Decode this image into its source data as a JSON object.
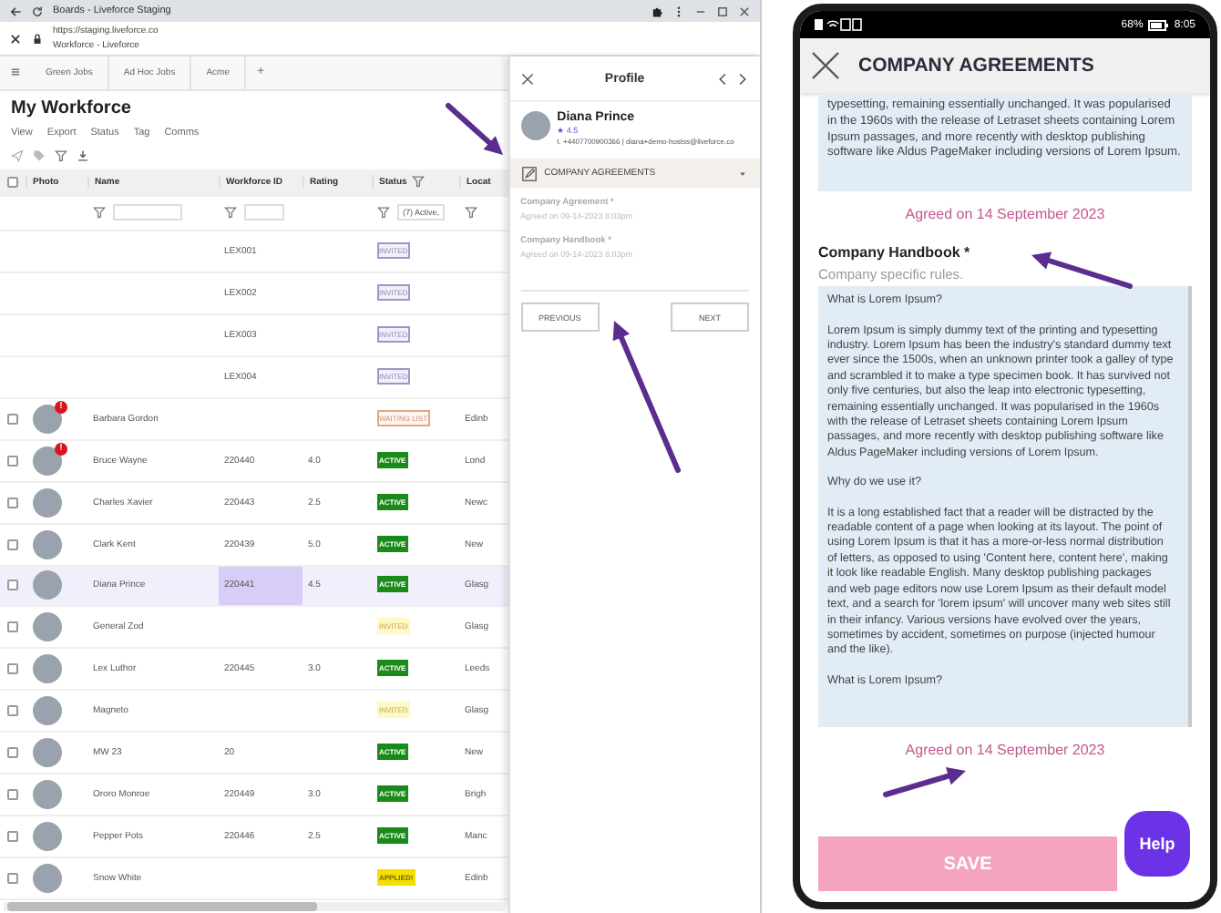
{
  "browser": {
    "tab_title": "Boards - Liveforce Staging",
    "url": "https://staging.liveforce.co",
    "site_title": "Workforce - Liveforce"
  },
  "tabs": [
    {
      "label": "Green Jobs",
      "selected": false
    },
    {
      "label": "Ad Hoc Jobs",
      "selected": false
    },
    {
      "label": "Acme",
      "selected": false
    }
  ],
  "add_tab": "+",
  "page": {
    "title": "My Workforce",
    "menu": [
      "View",
      "Export",
      "Status",
      "Tag",
      "Comms"
    ]
  },
  "table": {
    "select_all_checked": false,
    "columns": [
      {
        "label": "Photo",
        "filter": false,
        "header_filter": false
      },
      {
        "label": "Name",
        "filter": true,
        "header_filter": false
      },
      {
        "label": "Workforce ID",
        "filter": true,
        "header_filter": false
      },
      {
        "label": "Rating",
        "filter": false,
        "header_filter": false
      },
      {
        "label": "Status",
        "filter": true,
        "header_filter": true
      },
      {
        "label": "Locat",
        "filter": true,
        "header_filter": false
      }
    ],
    "status_filter": "(7) Active,",
    "rows": [
      {
        "kind": "invite",
        "workforce_id": "LEX001",
        "status": {
          "label": "INVITED",
          "kind": "invited"
        },
        "selected": false
      },
      {
        "kind": "invite",
        "workforce_id": "LEX002",
        "status": {
          "label": "INVITED",
          "kind": "invited"
        },
        "selected": false
      },
      {
        "kind": "invite",
        "workforce_id": "LEX003",
        "status": {
          "label": "INVITED",
          "kind": "invited"
        },
        "selected": false
      },
      {
        "kind": "invite",
        "workforce_id": "LEX004",
        "status": {
          "label": "INVITED",
          "kind": "invited"
        },
        "selected": false
      },
      {
        "kind": "person",
        "checked": false,
        "alert": "!",
        "name": "Barbara Gordon",
        "status": {
          "label": "WAITING LIST",
          "kind": "waiting"
        },
        "location": "Edinb",
        "selected": false
      },
      {
        "kind": "person",
        "checked": false,
        "alert": "!",
        "name": "Bruce Wayne",
        "workforce_id": "220440",
        "rating": "4.0",
        "status": {
          "label": "ACTIVE",
          "kind": "active"
        },
        "location": "Lond",
        "selected": false
      },
      {
        "kind": "person",
        "checked": false,
        "alert": false,
        "name": "Charles Xavier",
        "workforce_id": "220443",
        "rating": "2.5",
        "status": {
          "label": "ACTIVE",
          "kind": "active"
        },
        "location": "Newc",
        "selected": false
      },
      {
        "kind": "person",
        "checked": false,
        "alert": false,
        "name": "Clark Kent",
        "workforce_id": "220439",
        "rating": "5.0",
        "status": {
          "label": "ACTIVE",
          "kind": "active"
        },
        "location": "New",
        "selected": false
      },
      {
        "kind": "person",
        "checked": false,
        "alert": false,
        "name": "Diana Prince",
        "workforce_id": "220441",
        "rating": "4.5",
        "status": {
          "label": "ACTIVE",
          "kind": "active"
        },
        "location": "Glasg",
        "selected": true
      },
      {
        "kind": "person",
        "checked": false,
        "alert": false,
        "name": "General Zod",
        "status": {
          "label": "INVITED",
          "kind": "pending"
        },
        "location": "Glasg",
        "selected": false
      },
      {
        "kind": "person",
        "checked": false,
        "alert": false,
        "name": "Lex Luthor",
        "workforce_id": "220445",
        "rating": "3.0",
        "status": {
          "label": "ACTIVE",
          "kind": "active"
        },
        "location": "Leeds",
        "selected": false
      },
      {
        "kind": "person",
        "checked": false,
        "alert": false,
        "name": "Magneto",
        "status": {
          "label": "INVITED",
          "kind": "pending"
        },
        "location": "Glasg",
        "selected": false
      },
      {
        "kind": "person",
        "checked": false,
        "alert": false,
        "name": "MW 23",
        "workforce_id": "20",
        "status": {
          "label": "ACTIVE",
          "kind": "active"
        },
        "location": "New",
        "selected": false
      },
      {
        "kind": "person",
        "checked": false,
        "alert": false,
        "name": "Ororo Monroe",
        "workforce_id": "220449",
        "rating": "3.0",
        "status": {
          "label": "ACTIVE",
          "kind": "active"
        },
        "location": "Brigh",
        "selected": false
      },
      {
        "kind": "person",
        "checked": false,
        "alert": false,
        "name": "Pepper Pots",
        "workforce_id": "220446",
        "rating": "2.5",
        "status": {
          "label": "ACTIVE",
          "kind": "active"
        },
        "location": "Manc",
        "selected": false
      },
      {
        "kind": "person",
        "checked": false,
        "alert": false,
        "name": "Snow White",
        "status": {
          "label": "APPLIED!",
          "kind": "applied"
        },
        "location": "Edinb",
        "selected": false
      }
    ]
  },
  "profile": {
    "title": "Profile",
    "name": "Diana Prince",
    "star": "★",
    "rating": "4.5",
    "contact": "t. +4407700900366 | diana+demo-hostss@liveforce.co",
    "section": {
      "title": "COMPANY AGREEMENTS",
      "expanded": true
    },
    "items": [
      {
        "label": "Company Agreement *",
        "agreed": "Agreed on 09-14-2023 8:03pm"
      },
      {
        "label": "Company Handbook *",
        "agreed": "Agreed on 09-14-2023 8:03pm"
      }
    ],
    "buttons": [
      "PREVIOUS",
      "NEXT"
    ]
  },
  "phone": {
    "battery": "68%",
    "time": "8:05",
    "title": "COMPANY AGREEMENTS",
    "first_text": "typesetting, remaining essentially unchanged. It was popularised in the 1960s with the release of Letraset sheets containing Lorem Ipsum passages, and more recently with desktop publishing software like Aldus PageMaker including versions of Lorem Ipsum.",
    "first_agreed": "Agreed on 14 September 2023",
    "handbook": {
      "title": "Company Handbook *",
      "description": "Company specific rules.",
      "paragraphs": [
        "What is Lorem Ipsum?",
        "Lorem Ipsum is simply dummy text of the printing and typesetting industry. Lorem Ipsum has been the industry's standard dummy text ever since the 1500s, when an unknown printer took a galley of type and scrambled it to make a type specimen book. It has survived not only five centuries, but also the leap into electronic typesetting, remaining essentially unchanged. It was popularised in the 1960s with the release of Letraset sheets containing Lorem Ipsum passages, and more recently with desktop publishing software like Aldus PageMaker including versions of Lorem Ipsum.",
        "Why do we use it?",
        "It is a long established fact that a reader will be distracted by the readable content of a page when looking at its layout. The point of using Lorem Ipsum is that it has a more-or-less normal distribution of letters, as opposed to using 'Content here, content here', making it look like readable English. Many desktop publishing packages and web page editors now use Lorem Ipsum as their default model text, and a search for 'lorem ipsum' will uncover many web sites still in their infancy. Various versions have evolved over the years, sometimes by accident, sometimes on purpose (injected humour and the like).",
        "What is Lorem Ipsum?"
      ],
      "agreed": "Agreed on 14 September 2023"
    },
    "save": "SAVE",
    "help": "Help"
  }
}
